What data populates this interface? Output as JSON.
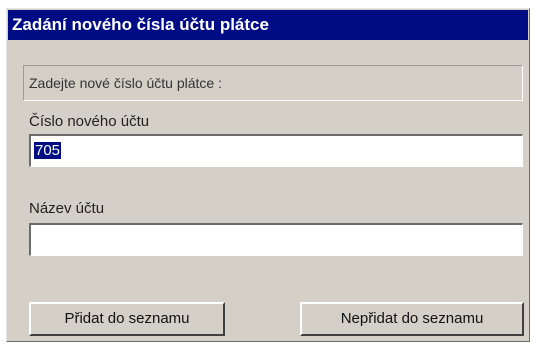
{
  "dialog": {
    "title": "Zadání nového čísla účtu plátce",
    "prompt": "Zadejte nové číslo účtu plátce :"
  },
  "fields": {
    "account_number_label": "Číslo nového účtu",
    "account_number_value": "705",
    "account_name_label": "Název účtu",
    "account_name_value": ""
  },
  "buttons": {
    "add_label": "Přidat do seznamu",
    "no_add_label": "Nepřidat do seznamu"
  }
}
